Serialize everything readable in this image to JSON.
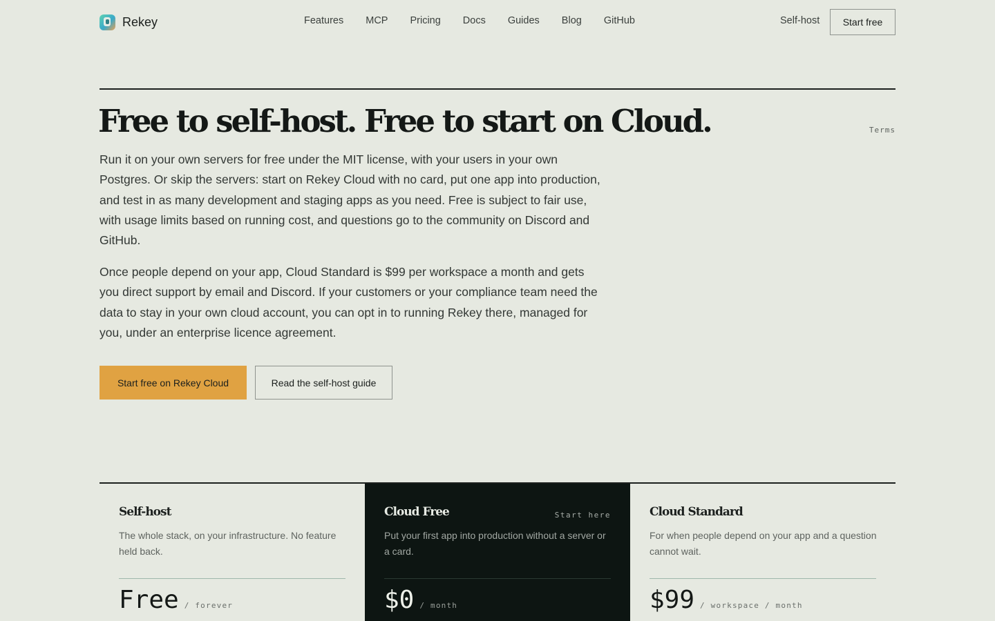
{
  "brand": {
    "name": "Rekey",
    "logo_icon": "rekey-logo-icon"
  },
  "nav": {
    "items": [
      "Features",
      "MCP",
      "Pricing",
      "Docs",
      "Guides",
      "Blog",
      "GitHub"
    ],
    "self_host": "Self-host",
    "start_free": "Start free"
  },
  "hero": {
    "title": "Free to self-host. Free to start on Cloud.",
    "terms": "Terms",
    "paragraph_1": "Run it on your own servers for free under the MIT license, with your users in your own Postgres. Or skip the servers: start on Rekey Cloud with no card, put one app into production, and test in as many development and staging apps as you need. Free is subject to fair use, with usage limits based on running cost, and questions go to the community on Discord and GitHub.",
    "paragraph_2": "Once people depend on your app, Cloud Standard is $99 per workspace a month and gets you direct support by email and Discord. If your customers or your compliance team need the data to stay in your own cloud account, you can opt in to running Rekey there, managed for you, under an enterprise licence agreement.",
    "cta_primary": "Start free on Rekey Cloud",
    "cta_secondary": "Read the self-host guide"
  },
  "plans": [
    {
      "name": "Self-host",
      "tag": "",
      "description": "The whole stack, on your infrastructure. No feature held back.",
      "price": "Free",
      "unit": "/ forever"
    },
    {
      "name": "Cloud Free",
      "tag": "Start here",
      "description": "Put your first app into production without a server or a card.",
      "price": "$0",
      "unit": "/ month"
    },
    {
      "name": "Cloud Standard",
      "tag": "",
      "description": "For when people depend on your app and a question cannot wait.",
      "price": "$99",
      "unit": "/ workspace / month"
    }
  ],
  "colors": {
    "background": "#e6e9e1",
    "accent": "#e0a242",
    "dark_card": "#0d1512",
    "text": "#1d211f"
  }
}
